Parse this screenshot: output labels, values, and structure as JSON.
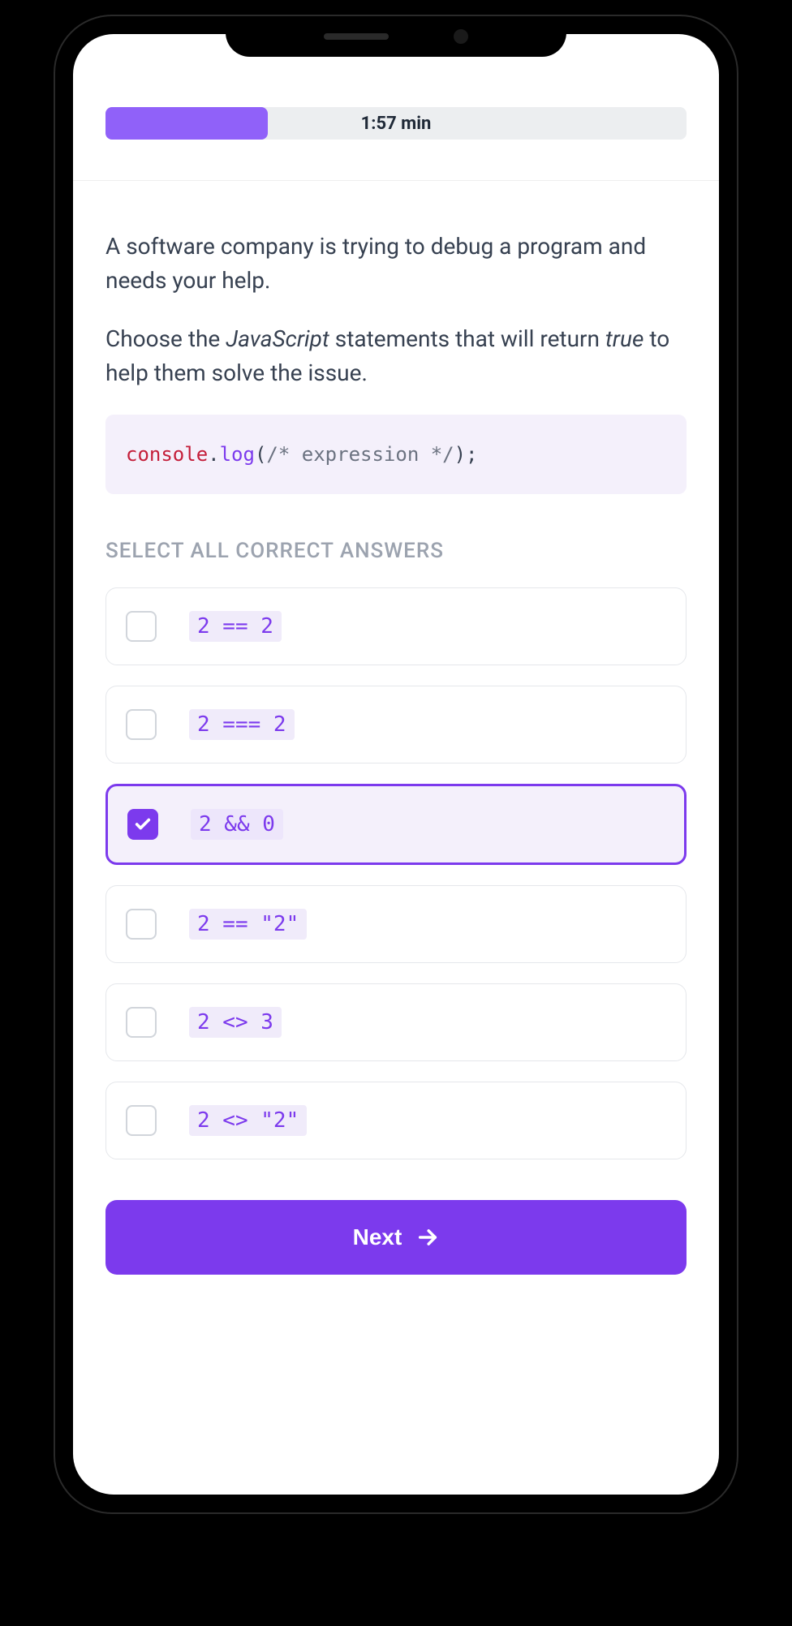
{
  "timer": {
    "text": "1:57 min",
    "progress_percent": 28
  },
  "question": {
    "intro": "A software company is trying to debug a program and needs your help.",
    "prompt_before_js": "Choose the ",
    "prompt_js": "JavaScript",
    "prompt_mid": " statements that will return ",
    "prompt_true": "true",
    "prompt_end": " to help them solve the issue."
  },
  "code": {
    "console": "console",
    "dot": ".",
    "log": "log",
    "open": "(",
    "comment": "/* expression */",
    "close": ");"
  },
  "instruction": "SELECT ALL CORRECT ANSWERS",
  "options": [
    {
      "code": "2 == 2",
      "selected": false
    },
    {
      "code": "2 === 2",
      "selected": false
    },
    {
      "code": "2 && 0",
      "selected": true
    },
    {
      "code": "2 == \"2\"",
      "selected": false
    },
    {
      "code": "2 <> 3",
      "selected": false
    },
    {
      "code": "2 <> \"2\"",
      "selected": false
    }
  ],
  "button": {
    "next": "Next"
  }
}
